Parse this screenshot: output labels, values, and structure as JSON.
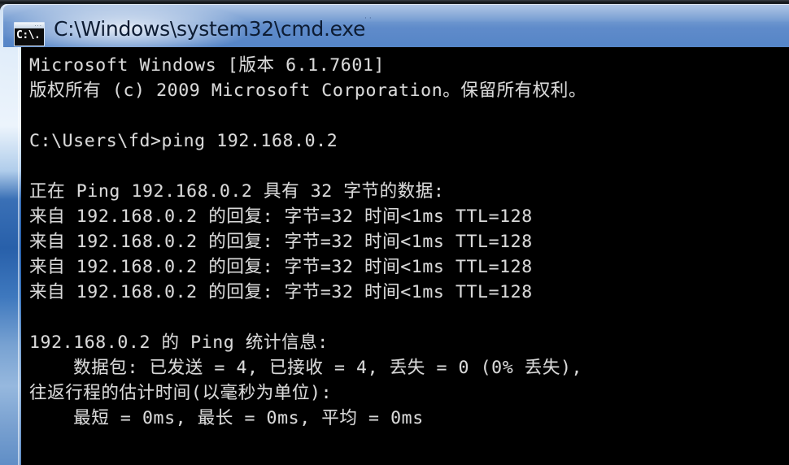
{
  "window": {
    "title": "C:\\Windows\\system32\\cmd.exe",
    "icon_name": "cmd-console-icon",
    "icon_glyph": "C:\\.",
    "title_bar_dots": "··",
    "titlebar_color": "#6f98d0",
    "frame_color": "#b9cde6",
    "console_background": "#000000",
    "console_foreground": "#d9d9d9"
  },
  "console": {
    "lines": [
      "Microsoft Windows [版本 6.1.7601]",
      "版权所有 (c) 2009 Microsoft Corporation。保留所有权利。",
      "",
      "C:\\Users\\fd>ping 192.168.0.2",
      "",
      "正在 Ping 192.168.0.2 具有 32 字节的数据:",
      "来自 192.168.0.2 的回复: 字节=32 时间<1ms TTL=128",
      "来自 192.168.0.2 的回复: 字节=32 时间<1ms TTL=128",
      "来自 192.168.0.2 的回复: 字节=32 时间<1ms TTL=128",
      "来自 192.168.0.2 的回复: 字节=32 时间<1ms TTL=128",
      "",
      "192.168.0.2 的 Ping 统计信息:",
      "    数据包: 已发送 = 4, 已接收 = 4, 丢失 = 0 (0% 丢失),",
      "往返行程的估计时间(以毫秒为单位):",
      "    最短 = 0ms, 最长 = 0ms, 平均 = 0ms"
    ],
    "text": "Microsoft Windows [版本 6.1.7601]\n版权所有 (c) 2009 Microsoft Corporation。保留所有权利。\n\nC:\\Users\\fd>ping 192.168.0.2\n\n正在 Ping 192.168.0.2 具有 32 字节的数据:\n来自 192.168.0.2 的回复: 字节=32 时间<1ms TTL=128\n来自 192.168.0.2 的回复: 字节=32 时间<1ms TTL=128\n来自 192.168.0.2 的回复: 字节=32 时间<1ms TTL=128\n来自 192.168.0.2 的回复: 字节=32 时间<1ms TTL=128\n\n192.168.0.2 的 Ping 统计信息:\n    数据包: 已发送 = 4, 已接收 = 4, 丢失 = 0 (0% 丢失),\n往返行程的估计时间(以毫秒为单位):\n    最短 = 0ms, 最长 = 0ms, 平均 = 0ms",
    "command": "ping 192.168.0.2",
    "prompt": "C:\\Users\\fd>",
    "target_host": "192.168.0.2",
    "os_version": "6.1.7601",
    "copyright_year": "2009",
    "packet_bytes": "32",
    "ttl": "128",
    "time": "<1ms",
    "sent": "4",
    "received": "4",
    "lost": "0",
    "lost_percent": "0%",
    "min_ms": "0ms",
    "max_ms": "0ms",
    "avg_ms": "0ms"
  }
}
